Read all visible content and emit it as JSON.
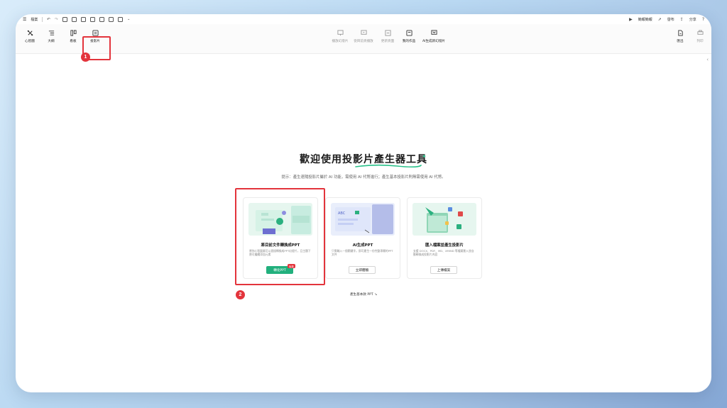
{
  "titlebar": {
    "file_menu": "檔案",
    "share_menu": "分享",
    "publish_menu": "發布",
    "present_menu": "簡報簡報"
  },
  "toolbar": {
    "left": [
      {
        "label": "心智圖",
        "icon": "mindmap-icon"
      },
      {
        "label": "大綱",
        "icon": "outline-icon"
      },
      {
        "label": "看板",
        "icon": "board-icon"
      },
      {
        "label": "投影片",
        "icon": "slides-icon"
      }
    ],
    "center": [
      {
        "label": "播放幻燈片",
        "icon": "play-slides-icon"
      },
      {
        "label": "從目前頁播放",
        "icon": "play-current-icon"
      },
      {
        "label": "更新頁面",
        "icon": "refresh-page-icon"
      },
      {
        "label": "我的作品",
        "icon": "my-works-icon"
      },
      {
        "label": "AI生成新幻燈片",
        "icon": "ai-slides-icon"
      }
    ],
    "right": [
      {
        "label": "匯出",
        "icon": "export-icon"
      },
      {
        "label": "列印",
        "icon": "print-icon"
      }
    ]
  },
  "annotations": {
    "step1": "1",
    "step2": "2"
  },
  "main": {
    "title": "歡迎使用投影片產生器工具",
    "hint": "提示：產生速隨投影片屬於 AI 功能，需使用 AI 代幣進行；產生基本投影片則無需使用 AI 代幣。",
    "cards": [
      {
        "title": "將目前文件轉換成PPT",
        "desc": "將你心智圖畫可以直接轉換成PPT幻燈片，且主題下層可繼續添加元素",
        "button": "轉化PPT",
        "tag": "免費"
      },
      {
        "title": "AI生成PPT",
        "desc": "只需輸入一個關鍵字，即可產生一份完整專屬的PPT文件",
        "button": "立即體驗"
      },
      {
        "title": "匯入檔案並產生投影片",
        "desc": "支援 DOCX、PDF、MD、XMIND 等檔案匯入並自動轉換成投影片內容",
        "button": "上傳檔案"
      }
    ],
    "footer_link": "產生基本款 PPT ↘"
  },
  "colors": {
    "accent_green": "#22b07d",
    "highlight_red": "#e3343c"
  }
}
